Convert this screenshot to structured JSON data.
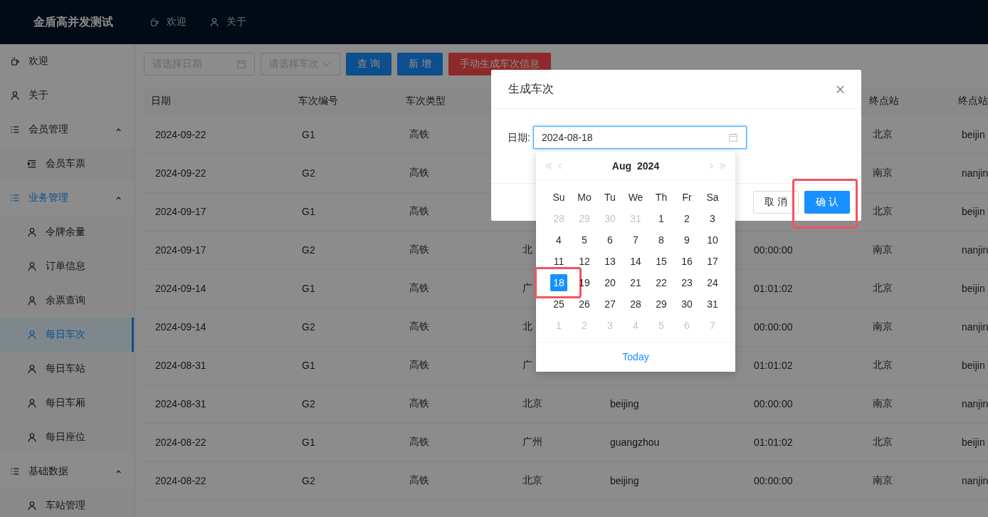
{
  "header": {
    "title": "金盾高并发测试",
    "nav": [
      {
        "label": "欢迎"
      },
      {
        "label": "关于"
      }
    ]
  },
  "sidebar": {
    "items": [
      {
        "kind": "item",
        "label": "欢迎",
        "selected": false
      },
      {
        "kind": "item",
        "label": "关于",
        "selected": false
      },
      {
        "kind": "group",
        "label": "会员管理",
        "active": false,
        "expanded": true,
        "children": [
          {
            "label": "会员车票",
            "selected": false
          }
        ]
      },
      {
        "kind": "group",
        "label": "业务管理",
        "active": true,
        "expanded": true,
        "children": [
          {
            "label": "令牌余量",
            "selected": false
          },
          {
            "label": "订单信息",
            "selected": false
          },
          {
            "label": "余票查询",
            "selected": false
          },
          {
            "label": "每日车次",
            "selected": true
          },
          {
            "label": "每日车站",
            "selected": false
          },
          {
            "label": "每日车厢",
            "selected": false
          },
          {
            "label": "每日座位",
            "selected": false
          }
        ]
      },
      {
        "kind": "group",
        "label": "基础数据",
        "active": false,
        "expanded": true,
        "children": [
          {
            "label": "车站管理",
            "selected": false
          }
        ]
      }
    ]
  },
  "toolbar": {
    "date_filter": {
      "placeholder": "请选择日期"
    },
    "train_filter": {
      "placeholder": "请选择车次"
    },
    "buttons": [
      {
        "label": "查 询",
        "kind": "primary"
      },
      {
        "label": "新 增",
        "kind": "primary"
      },
      {
        "label": "手动生成车次信息",
        "kind": "danger"
      }
    ]
  },
  "table": {
    "columns": [
      "日期",
      "车次编号",
      "车次类型",
      null,
      null,
      null,
      "终点站",
      "终点站"
    ],
    "rows": [
      {
        "cells": [
          "2024-09-22",
          "G1",
          "高铁",
          null,
          null,
          null,
          "北京",
          "beijin"
        ]
      },
      {
        "cells": [
          "2024-09-22",
          "G2",
          "高铁",
          null,
          null,
          null,
          "南京",
          "nanjin"
        ]
      },
      {
        "cells": [
          "2024-09-17",
          "G1",
          "高铁",
          null,
          null,
          null,
          "北京",
          "beijin"
        ]
      },
      {
        "cells": [
          "2024-09-17",
          "G2",
          "高铁",
          "北",
          null,
          "00:00:00",
          "南京",
          "nanjin"
        ]
      },
      {
        "cells": [
          "2024-09-14",
          "G1",
          "高铁",
          "广",
          null,
          "01:01:02",
          "北京",
          "beijin"
        ]
      },
      {
        "cells": [
          "2024-09-14",
          "G2",
          "高铁",
          "北",
          null,
          "00:00:00",
          "南京",
          "nanjin"
        ]
      },
      {
        "cells": [
          "2024-08-31",
          "G1",
          "高铁",
          "广",
          null,
          "01:01:02",
          "北京",
          "beijin"
        ]
      },
      {
        "cells": [
          "2024-08-31",
          "G2",
          "高铁",
          "北京",
          "beijing",
          "00:00:00",
          "南京",
          "nanjin"
        ]
      },
      {
        "cells": [
          "2024-08-22",
          "G1",
          "高铁",
          "广州",
          "guangzhou",
          "01:01:02",
          "北京",
          "beijin"
        ]
      },
      {
        "cells": [
          "2024-08-22",
          "G2",
          "高铁",
          "北京",
          "beijing",
          "00:00:00",
          "南京",
          "nanjin"
        ]
      }
    ]
  },
  "modal": {
    "title": "生成车次",
    "field": {
      "label": "日期:",
      "value": "2024-08-18",
      "focused": true
    },
    "buttons": [
      {
        "label": "取 消",
        "kind": "default",
        "highlighted": false
      },
      {
        "label": "确 认",
        "kind": "primary",
        "highlighted": true
      }
    ]
  },
  "calendar": {
    "month": "Aug",
    "year": "2024",
    "weekdays": [
      "Su",
      "Mo",
      "Tu",
      "We",
      "Th",
      "Fr",
      "Sa"
    ],
    "today_label": "Today",
    "weeks": [
      [
        {
          "day": "28",
          "in_month": false,
          "selected": false,
          "highlighted": false
        },
        {
          "day": "29",
          "in_month": false,
          "selected": false,
          "highlighted": false
        },
        {
          "day": "30",
          "in_month": false,
          "selected": false,
          "highlighted": false
        },
        {
          "day": "31",
          "in_month": false,
          "selected": false,
          "highlighted": false
        },
        {
          "day": "1",
          "in_month": true,
          "selected": false,
          "highlighted": false
        },
        {
          "day": "2",
          "in_month": true,
          "selected": false,
          "highlighted": false
        },
        {
          "day": "3",
          "in_month": true,
          "selected": false,
          "highlighted": false
        }
      ],
      [
        {
          "day": "4",
          "in_month": true,
          "selected": false,
          "highlighted": false
        },
        {
          "day": "5",
          "in_month": true,
          "selected": false,
          "highlighted": false
        },
        {
          "day": "6",
          "in_month": true,
          "selected": false,
          "highlighted": false
        },
        {
          "day": "7",
          "in_month": true,
          "selected": false,
          "highlighted": false
        },
        {
          "day": "8",
          "in_month": true,
          "selected": false,
          "highlighted": false
        },
        {
          "day": "9",
          "in_month": true,
          "selected": false,
          "highlighted": false
        },
        {
          "day": "10",
          "in_month": true,
          "selected": false,
          "highlighted": false
        }
      ],
      [
        {
          "day": "11",
          "in_month": true,
          "selected": false,
          "highlighted": false
        },
        {
          "day": "12",
          "in_month": true,
          "selected": false,
          "highlighted": false
        },
        {
          "day": "13",
          "in_month": true,
          "selected": false,
          "highlighted": false
        },
        {
          "day": "14",
          "in_month": true,
          "selected": false,
          "highlighted": false
        },
        {
          "day": "15",
          "in_month": true,
          "selected": false,
          "highlighted": false
        },
        {
          "day": "16",
          "in_month": true,
          "selected": false,
          "highlighted": false
        },
        {
          "day": "17",
          "in_month": true,
          "selected": false,
          "highlighted": false
        }
      ],
      [
        {
          "day": "18",
          "in_month": true,
          "selected": true,
          "highlighted": true
        },
        {
          "day": "19",
          "in_month": true,
          "selected": false,
          "highlighted": false
        },
        {
          "day": "20",
          "in_month": true,
          "selected": false,
          "highlighted": false
        },
        {
          "day": "21",
          "in_month": true,
          "selected": false,
          "highlighted": false
        },
        {
          "day": "22",
          "in_month": true,
          "selected": false,
          "highlighted": false
        },
        {
          "day": "23",
          "in_month": true,
          "selected": false,
          "highlighted": false
        },
        {
          "day": "24",
          "in_month": true,
          "selected": false,
          "highlighted": false
        }
      ],
      [
        {
          "day": "25",
          "in_month": true,
          "selected": false,
          "highlighted": false
        },
        {
          "day": "26",
          "in_month": true,
          "selected": false,
          "highlighted": false
        },
        {
          "day": "27",
          "in_month": true,
          "selected": false,
          "highlighted": false
        },
        {
          "day": "28",
          "in_month": true,
          "selected": false,
          "highlighted": false
        },
        {
          "day": "29",
          "in_month": true,
          "selected": false,
          "highlighted": false
        },
        {
          "day": "30",
          "in_month": true,
          "selected": false,
          "highlighted": false
        },
        {
          "day": "31",
          "in_month": true,
          "selected": false,
          "highlighted": false
        }
      ],
      [
        {
          "day": "1",
          "in_month": false,
          "selected": false,
          "highlighted": false
        },
        {
          "day": "2",
          "in_month": false,
          "selected": false,
          "highlighted": false
        },
        {
          "day": "3",
          "in_month": false,
          "selected": false,
          "highlighted": false
        },
        {
          "day": "4",
          "in_month": false,
          "selected": false,
          "highlighted": false
        },
        {
          "day": "5",
          "in_month": false,
          "selected": false,
          "highlighted": false
        },
        {
          "day": "6",
          "in_month": false,
          "selected": false,
          "highlighted": false
        },
        {
          "day": "7",
          "in_month": false,
          "selected": false,
          "highlighted": false
        }
      ]
    ]
  }
}
